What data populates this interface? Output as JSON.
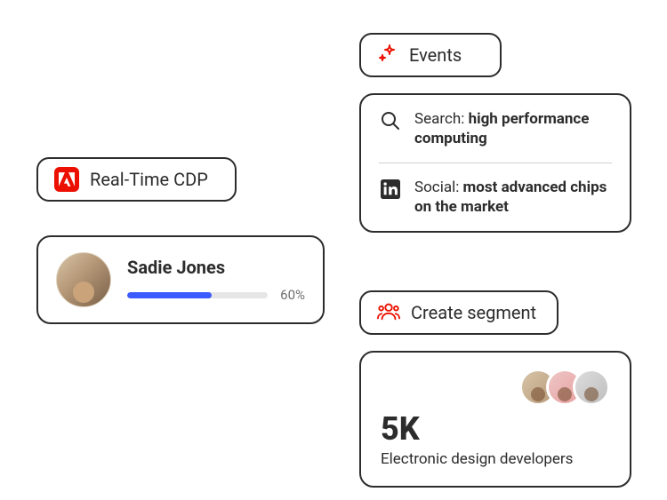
{
  "cdp": {
    "label": "Real-Time CDP"
  },
  "profile": {
    "name": "Sadie Jones",
    "progress_pct": "60%",
    "progress_fill_width": "60%"
  },
  "events": {
    "label": "Events",
    "items": [
      {
        "prefix": "Search: ",
        "value": "high performance computing"
      },
      {
        "prefix": "Social: ",
        "value": "most advanced chips on the market"
      }
    ]
  },
  "segment": {
    "label": "Create segment",
    "count": "5K",
    "description": "Electronic design developers"
  }
}
